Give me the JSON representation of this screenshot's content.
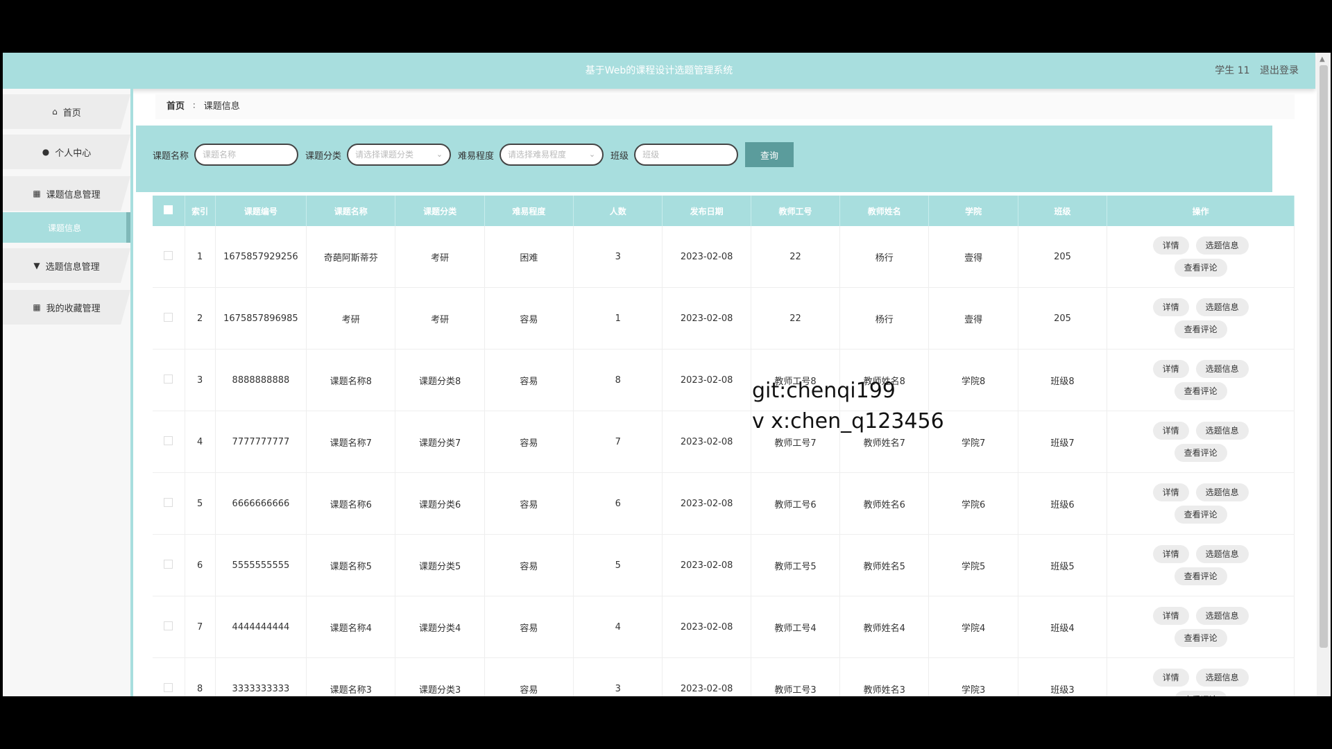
{
  "header": {
    "system_title": "基于Web的课程设计选题管理系统",
    "user_label": "学生 11",
    "logout_label": "退出登录"
  },
  "sidebar": {
    "items": [
      {
        "label": "首页",
        "icon": "home-icon"
      },
      {
        "label": "个人中心",
        "icon": "user-icon"
      },
      {
        "label": "课题信息管理",
        "icon": "grid-icon"
      },
      {
        "label": "选题信息管理",
        "icon": "pin-icon"
      },
      {
        "label": "我的收藏管理",
        "icon": "grid-icon"
      }
    ],
    "active_sub": "课题信息"
  },
  "breadcrumb": {
    "home": "首页",
    "separator": "∶",
    "current": "课题信息"
  },
  "search": {
    "name_label": "课题名称",
    "name_placeholder": "课题名称",
    "category_label": "课题分类",
    "category_placeholder": "请选择课题分类",
    "difficulty_label": "难易程度",
    "difficulty_placeholder": "请选择难易程度",
    "class_label": "班级",
    "class_placeholder": "班级",
    "query_label": "查询"
  },
  "table": {
    "headers": [
      "索引",
      "课题编号",
      "课题名称",
      "课题分类",
      "难易程度",
      "人数",
      "发布日期",
      "教师工号",
      "教师姓名",
      "学院",
      "班级",
      "操作"
    ],
    "rows": [
      [
        "1",
        "1675857929256",
        "奇葩阿斯蒂芬",
        "考研",
        "困难",
        "3",
        "2023-02-08",
        "22",
        "杨行",
        "壹得",
        "205"
      ],
      [
        "2",
        "1675857896985",
        "考研",
        "考研",
        "容易",
        "1",
        "2023-02-08",
        "22",
        "杨行",
        "壹得",
        "205"
      ],
      [
        "3",
        "8888888888",
        "课题名称8",
        "课题分类8",
        "容易",
        "8",
        "2023-02-08",
        "教师工号8",
        "教师姓名8",
        "学院8",
        "班级8"
      ],
      [
        "4",
        "7777777777",
        "课题名称7",
        "课题分类7",
        "容易",
        "7",
        "2023-02-08",
        "教师工号7",
        "教师姓名7",
        "学院7",
        "班级7"
      ],
      [
        "5",
        "6666666666",
        "课题名称6",
        "课题分类6",
        "容易",
        "6",
        "2023-02-08",
        "教师工号6",
        "教师姓名6",
        "学院6",
        "班级6"
      ],
      [
        "6",
        "5555555555",
        "课题名称5",
        "课题分类5",
        "容易",
        "5",
        "2023-02-08",
        "教师工号5",
        "教师姓名5",
        "学院5",
        "班级5"
      ],
      [
        "7",
        "4444444444",
        "课题名称4",
        "课题分类4",
        "容易",
        "4",
        "2023-02-08",
        "教师工号4",
        "教师姓名4",
        "学院4",
        "班级4"
      ],
      [
        "8",
        "3333333333",
        "课题名称3",
        "课题分类3",
        "容易",
        "3",
        "2023-02-08",
        "教师工号3",
        "教师姓名3",
        "学院3",
        "班级3"
      ]
    ],
    "actions": {
      "detail": "详情",
      "select": "选题信息",
      "comments": "查看评论"
    }
  },
  "watermark": {
    "line1": "git:chenqi199",
    "line2": "v x:chen_q123456"
  },
  "colors": {
    "accent": "#a8dede",
    "button": "#5b9c9c"
  }
}
